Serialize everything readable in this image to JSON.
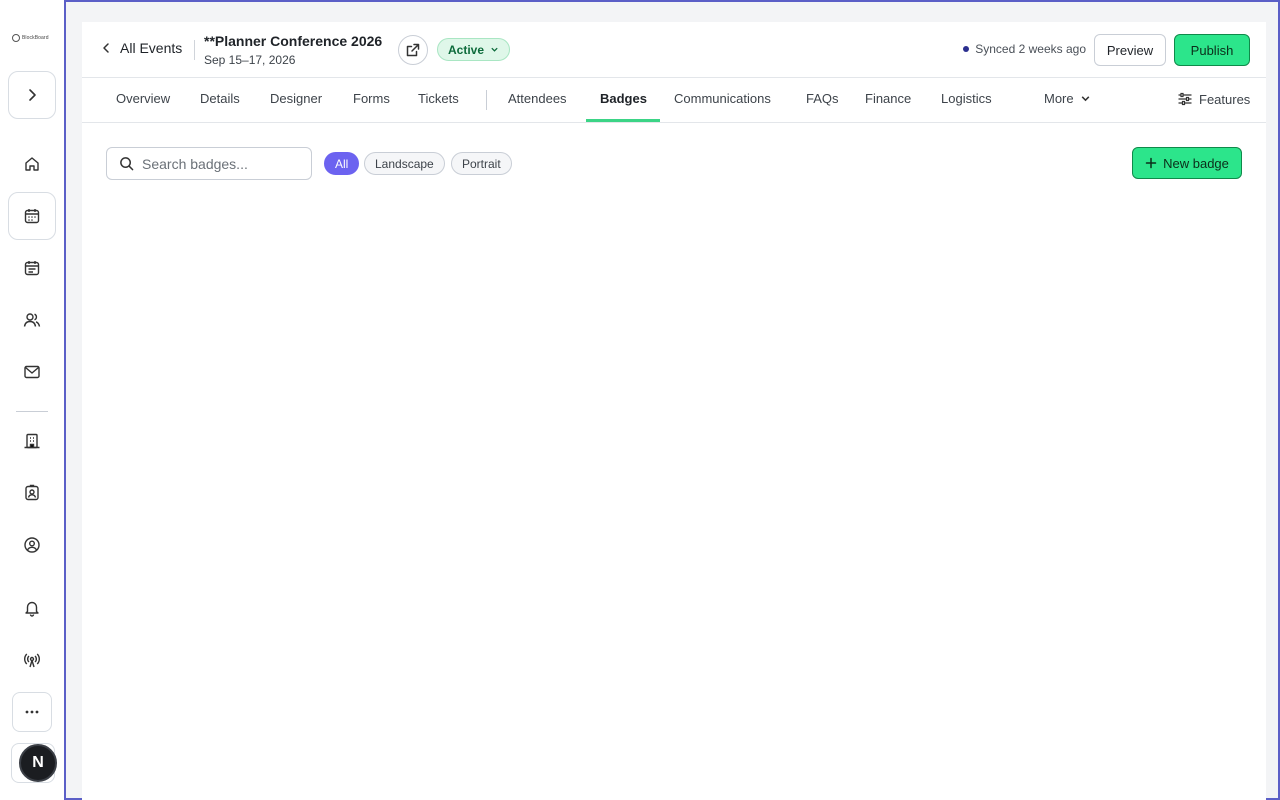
{
  "sidebar": {
    "logo_text": "BlockBoard",
    "expand_icon": "chevron-right-icon",
    "items": [
      {
        "name": "home",
        "icon": "home-icon"
      },
      {
        "name": "events",
        "icon": "calendar-icon"
      },
      {
        "name": "schedule",
        "icon": "calendar-list-icon"
      },
      {
        "name": "people",
        "icon": "users-icon"
      },
      {
        "name": "mail",
        "icon": "mail-icon"
      },
      {
        "name": "venues",
        "icon": "building-icon"
      },
      {
        "name": "badges",
        "icon": "id-badge-icon"
      },
      {
        "name": "account",
        "icon": "user-circle-icon"
      },
      {
        "name": "notifications",
        "icon": "bell-icon"
      },
      {
        "name": "broadcast",
        "icon": "broadcast-icon"
      },
      {
        "name": "more",
        "icon": "ellipsis-icon"
      }
    ],
    "avatar_initial": "N"
  },
  "header": {
    "back_label": "All Events",
    "title": "**Planner Conference 2026",
    "dates": "Sep 15–17, 2026",
    "status": "Active",
    "synced": "Synced 2 weeks ago",
    "preview_label": "Preview",
    "publish_label": "Publish"
  },
  "tabs": {
    "items": [
      "Overview",
      "Details",
      "Designer",
      "Forms",
      "Tickets",
      "Attendees",
      "Badges",
      "Communications",
      "FAQs",
      "Finance",
      "Logistics"
    ],
    "active": "Badges",
    "more_label": "More",
    "features_label": "Features"
  },
  "badges": {
    "search_placeholder": "Search badges...",
    "filters": [
      "All",
      "Landscape",
      "Portrait"
    ],
    "active_filter": "All",
    "new_label": "New badge"
  },
  "colors": {
    "accent_green": "#2ce58b",
    "accent_purple": "#6c63f0",
    "frame_border": "#5b5fc7"
  }
}
